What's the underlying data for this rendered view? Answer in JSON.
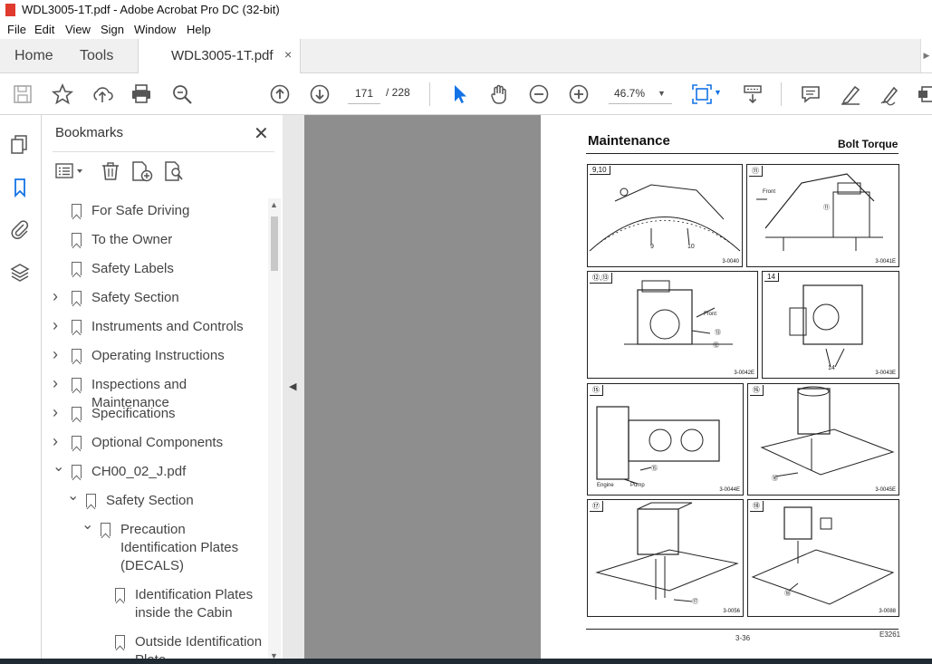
{
  "window": {
    "title": "WDL3005-1T.pdf - Adobe Acrobat Pro DC (32-bit)"
  },
  "menu": [
    "File",
    "Edit",
    "View",
    "Sign",
    "Window",
    "Help"
  ],
  "tabs": {
    "home": "Home",
    "tools": "Tools",
    "document": "WDL3005-1T.pdf",
    "close": "×"
  },
  "toolbar": {
    "current_page": "171",
    "total_pages": "/ 228",
    "zoom": "46.7%"
  },
  "bookmarks": {
    "title": "Bookmarks",
    "close": "✕",
    "items": [
      {
        "label": "For Safe Driving",
        "expandable": false,
        "expanded": false,
        "level": 0
      },
      {
        "label": "To the Owner",
        "expandable": false,
        "expanded": false,
        "level": 0
      },
      {
        "label": "Safety Labels",
        "expandable": false,
        "expanded": false,
        "level": 0
      },
      {
        "label": "Safety Section",
        "expandable": true,
        "expanded": false,
        "level": 0
      },
      {
        "label": "Instruments and Controls",
        "expandable": true,
        "expanded": false,
        "level": 0
      },
      {
        "label": "Operating Instructions",
        "expandable": true,
        "expanded": false,
        "level": 0
      },
      {
        "label": "Inspections and Maintenance",
        "expandable": true,
        "expanded": false,
        "level": 0
      },
      {
        "label": "Specifications",
        "expandable": true,
        "expanded": false,
        "level": 0
      },
      {
        "label": "Optional Components",
        "expandable": true,
        "expanded": false,
        "level": 0
      },
      {
        "label": "CH00_02_J.pdf",
        "expandable": true,
        "expanded": true,
        "level": 0
      },
      {
        "label": "Safety Section",
        "expandable": true,
        "expanded": true,
        "level": 1
      },
      {
        "label": "Precaution\nIdentification Plates\n(DECALS)",
        "expandable": true,
        "expanded": true,
        "level": 2
      },
      {
        "label": "Identification Plates\ninside the Cabin",
        "expandable": false,
        "expanded": false,
        "level": 3
      },
      {
        "label": "Outside Identification\nPlate",
        "expandable": false,
        "expanded": false,
        "level": 3
      }
    ]
  },
  "document_page": {
    "section_title": "Maintenance",
    "header_right": "Bolt Torque",
    "page_number": "3-36",
    "doc_code": "E3261",
    "figures": [
      {
        "label": "9,10",
        "code": "3-0040",
        "callouts": [
          "9",
          "10"
        ]
      },
      {
        "label": "⑪",
        "code": "3-0041E",
        "callouts": [
          "Front",
          "⑪"
        ]
      },
      {
        "label": "⑫,⑬",
        "code": "3-0042E",
        "callouts": [
          "Front",
          "⑬",
          "⑫"
        ]
      },
      {
        "label": "14",
        "code": "3-0043E",
        "callouts": [
          "14"
        ]
      },
      {
        "label": "⑮",
        "code": "3-0044E",
        "callouts": [
          "Engine",
          "Pump",
          "⑮"
        ]
      },
      {
        "label": "⑯",
        "code": "3-0045E",
        "callouts": [
          "⑯"
        ]
      },
      {
        "label": "⑰",
        "code": "3-0056",
        "callouts": [
          "⑰"
        ]
      },
      {
        "label": "⑱",
        "code": "3-0088",
        "callouts": [
          "⑱"
        ]
      }
    ]
  }
}
